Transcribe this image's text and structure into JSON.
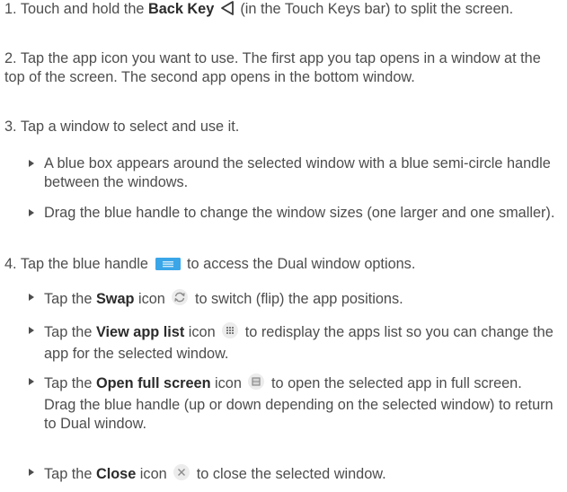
{
  "steps": [
    {
      "number": "1.",
      "pre": "Touch and hold the ",
      "bold": "Back Key",
      "icon": "back-triangle-icon",
      "post": " (in the Touch Keys bar) to split the screen."
    },
    {
      "number": "2.",
      "text": "Tap the app icon you want to use. The first app you tap opens in a window at the top of the screen. The second app opens in the bottom window."
    },
    {
      "number": "3.",
      "text": "Tap a window to select and use it.",
      "bullets": [
        "A blue box appears around the selected window with a blue semi-circle handle between the windows.",
        "Drag the blue handle to change the window sizes (one larger and one smaller)."
      ]
    },
    {
      "number": "4.",
      "pre": "Tap the blue handle",
      "icon": "blue-handle-icon",
      "post": "to access the Dual window options.",
      "bullets": [
        {
          "pre": "Tap the ",
          "bold": "Swap",
          "mid": " icon",
          "icon": "swap-icon",
          "post": "to switch (flip) the app positions."
        },
        {
          "pre": "Tap the ",
          "bold": "View app list",
          "mid": " icon",
          "icon": "app-list-icon",
          "post": "to redisplay the apps list so you can change the app for the selected window."
        },
        {
          "pre": "Tap the ",
          "bold": "Open full screen",
          "mid": " icon",
          "icon": "full-screen-icon",
          "post": "to open the selected app in full screen. Drag the blue handle (up or down depending on the selected window) to return to Dual window."
        },
        {
          "pre": "Tap the ",
          "bold": "Close",
          "mid": " icon",
          "icon": "close-icon",
          "post": "to close the selected window."
        }
      ]
    }
  ],
  "colors": {
    "text": "#4d4d4d",
    "accent_blue": "#3aa6e8"
  }
}
